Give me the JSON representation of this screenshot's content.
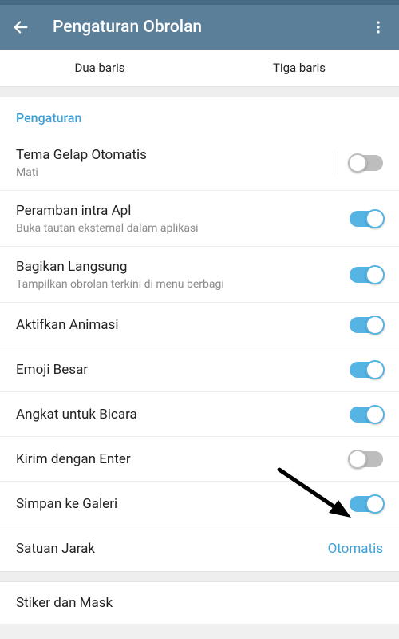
{
  "header": {
    "title": "Pengaturan Obrolan"
  },
  "tabs": {
    "left": "Dua baris",
    "right": "Tiga baris"
  },
  "section_settings": {
    "header": "Pengaturan",
    "dark_theme": {
      "title": "Tema Gelap Otomatis",
      "sub": "Mati"
    },
    "in_app_browser": {
      "title": "Peramban intra Apl",
      "sub": "Buka tautan eksternal dalam aplikasi"
    },
    "direct_share": {
      "title": "Bagikan Langsung",
      "sub": "Tampilkan obrolan terkini di menu berbagi"
    },
    "animations": {
      "title": "Aktifkan Animasi"
    },
    "big_emoji": {
      "title": "Emoji Besar"
    },
    "raise_to_speak": {
      "title": "Angkat untuk Bicara"
    },
    "send_enter": {
      "title": "Kirim dengan Enter"
    },
    "save_gallery": {
      "title": "Simpan ke Galeri"
    },
    "distance_unit": {
      "title": "Satuan Jarak",
      "value": "Otomatis"
    }
  },
  "section_stickers": {
    "title": "Stiker dan Mask"
  }
}
